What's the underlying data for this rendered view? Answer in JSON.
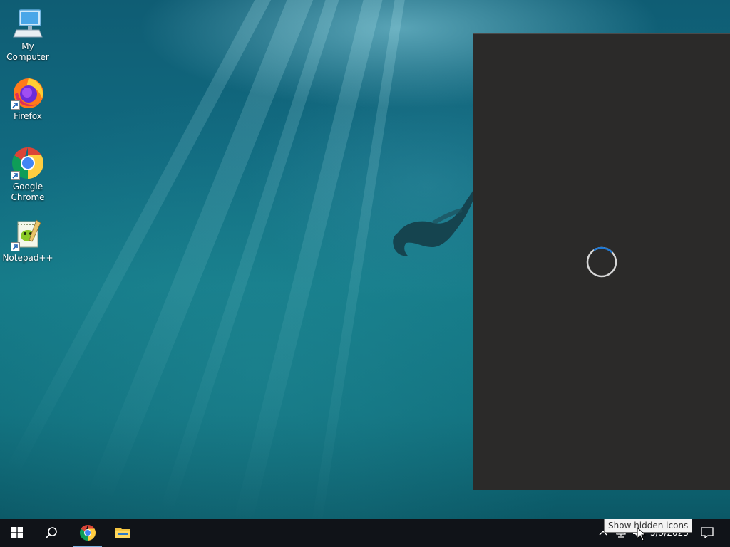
{
  "desktop": {
    "wallpaper_colors": {
      "deep": "#0b4f63",
      "mid": "#157a88",
      "light": "#96dceb"
    },
    "icons": [
      {
        "label": "My Computer",
        "icon": "computer-icon"
      },
      {
        "label": "Firefox",
        "icon": "firefox-icon"
      },
      {
        "label": "Google Chrome",
        "icon": "chrome-icon"
      },
      {
        "label": "Notepad++",
        "icon": "notepad-plus-plus-icon"
      }
    ]
  },
  "loading_window": {
    "background": "#2b2a29",
    "spinner_color": "#1e78d4",
    "state": "loading"
  },
  "taskbar": {
    "background": "#101318",
    "pinned": [
      {
        "name": "start-button",
        "icon": "windows-logo-icon"
      },
      {
        "name": "search-button",
        "icon": "search-icon"
      },
      {
        "name": "chrome-taskbar-button",
        "icon": "chrome-icon",
        "active": true
      },
      {
        "name": "file-explorer-button",
        "icon": "folder-icon"
      }
    ],
    "tray": {
      "tooltip": "Show hidden icons",
      "date": "5/9/2023",
      "icons": [
        "chevron-up-icon",
        "network-icon",
        "volume-icon",
        "notification-icon"
      ]
    }
  }
}
